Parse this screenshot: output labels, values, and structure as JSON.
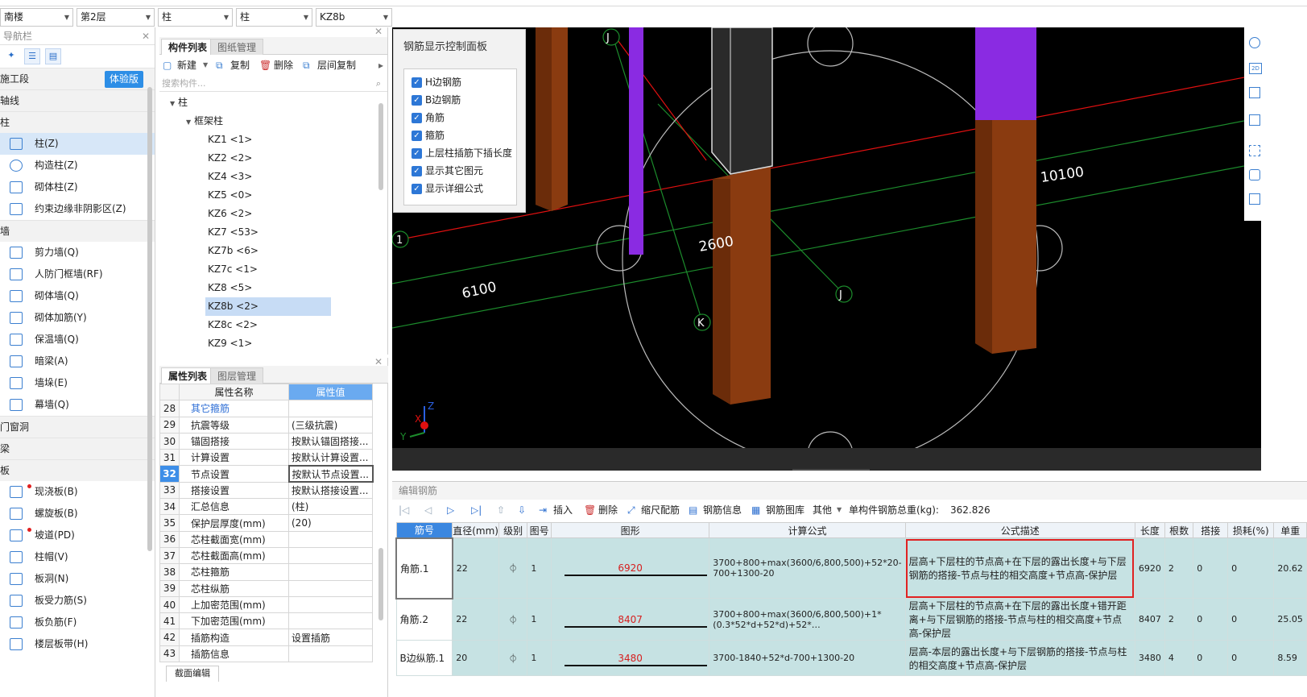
{
  "top_selectors": [
    {
      "value": "南楼"
    },
    {
      "value": "第2层"
    },
    {
      "value": "柱"
    },
    {
      "value": "柱"
    },
    {
      "value": "KZ8b"
    }
  ],
  "nav": {
    "title": "导航栏",
    "badge": "体验版",
    "groups": [
      {
        "label": "施工段"
      },
      {
        "label": "轴线"
      },
      {
        "label": "柱"
      },
      {
        "label": "墙"
      },
      {
        "label": "门窗洞"
      },
      {
        "label": "梁"
      },
      {
        "label": "板"
      }
    ],
    "column_items": [
      {
        "label": "柱(Z)"
      },
      {
        "label": "构造柱(Z)"
      },
      {
        "label": "砌体柱(Z)"
      },
      {
        "label": "约束边缘非阴影区(Z)"
      }
    ],
    "wall_items": [
      {
        "label": "剪力墙(Q)"
      },
      {
        "label": "人防门框墙(RF)"
      },
      {
        "label": "砌体墙(Q)"
      },
      {
        "label": "砌体加筋(Y)"
      },
      {
        "label": "保温墙(Q)"
      },
      {
        "label": "暗梁(A)"
      },
      {
        "label": "墙垛(E)"
      },
      {
        "label": "幕墙(Q)"
      }
    ],
    "slab_items": [
      {
        "label": "现浇板(B)"
      },
      {
        "label": "螺旋板(B)"
      },
      {
        "label": "坡道(PD)"
      },
      {
        "label": "柱帽(V)"
      },
      {
        "label": "板洞(N)"
      },
      {
        "label": "板受力筋(S)"
      },
      {
        "label": "板负筋(F)"
      },
      {
        "label": "楼层板带(H)"
      }
    ]
  },
  "components": {
    "tabs": [
      "构件列表",
      "图纸管理"
    ],
    "toolbar": {
      "new": "新建",
      "copy": "复制",
      "delete": "删除",
      "floor_copy": "层间复制"
    },
    "search_placeholder": "搜索构件...",
    "root": "柱",
    "sub": "框架柱",
    "items": [
      "KZ1 <1>",
      "KZ2 <2>",
      "KZ4 <3>",
      "KZ5 <0>",
      "KZ6 <2>",
      "KZ7 <53>",
      "KZ7b <6>",
      "KZ7c <1>",
      "KZ8 <5>",
      "KZ8b <2>",
      "KZ8c <2>",
      "KZ9 <1>"
    ],
    "selected": "KZ8b <2>"
  },
  "properties": {
    "tabs": [
      "属性列表",
      "图层管理"
    ],
    "headers": {
      "name": "属性名称",
      "value": "属性值"
    },
    "rows": [
      {
        "n": "28",
        "k": "其它箍筋",
        "v": ""
      },
      {
        "n": "29",
        "k": "抗震等级",
        "v": "(三级抗震)"
      },
      {
        "n": "30",
        "k": "锚固搭接",
        "v": "按默认锚固搭接..."
      },
      {
        "n": "31",
        "k": "计算设置",
        "v": "按默认计算设置..."
      },
      {
        "n": "32",
        "k": "节点设置",
        "v": "按默认节点设置..."
      },
      {
        "n": "33",
        "k": "搭接设置",
        "v": "按默认搭接设置..."
      },
      {
        "n": "34",
        "k": "汇总信息",
        "v": "(柱)"
      },
      {
        "n": "35",
        "k": "保护层厚度(mm)",
        "v": "(20)"
      },
      {
        "n": "36",
        "k": "芯柱截面宽(mm)",
        "v": ""
      },
      {
        "n": "37",
        "k": "芯柱截面高(mm)",
        "v": ""
      },
      {
        "n": "38",
        "k": "芯柱箍筋",
        "v": ""
      },
      {
        "n": "39",
        "k": "芯柱纵筋",
        "v": ""
      },
      {
        "n": "40",
        "k": "上加密范围(mm)",
        "v": ""
      },
      {
        "n": "41",
        "k": "下加密范围(mm)",
        "v": ""
      },
      {
        "n": "42",
        "k": "插筋构造",
        "v": "设置插筋"
      },
      {
        "n": "43",
        "k": "插筋信息",
        "v": ""
      }
    ],
    "footer_tab": "截面编辑"
  },
  "rebar_panel": {
    "title": "钢筋显示控制面板",
    "options": [
      "H边钢筋",
      "B边钢筋",
      "角筋",
      "箍筋",
      "上层柱插筋下插长度",
      "显示其它图元",
      "显示详细公式"
    ]
  },
  "view_labels": {
    "dims": [
      "10100",
      "2600",
      "6100"
    ],
    "axes": [
      "J",
      "J",
      "K",
      "1"
    ],
    "gizmo": [
      "Z",
      "X",
      "Y"
    ]
  },
  "colors": {
    "accent": "#2d8ee6",
    "column": "#8a3b10",
    "rebar": "#8a2be2",
    "axis_red": "#e01010",
    "axis_green": "#1c8c2c"
  },
  "editor": {
    "title": "编辑钢筋",
    "toolbar": {
      "insert": "插入",
      "delete": "删除",
      "scale": "缩尺配筋",
      "info": "钢筋信息",
      "library": "钢筋图库",
      "other": "其他",
      "total_label": "单构件钢筋总重(kg):",
      "total": "362.826"
    },
    "headers": [
      "筋号",
      "直径(mm)",
      "级别",
      "图号",
      "图形",
      "计算公式",
      "公式描述",
      "长度",
      "根数",
      "搭接",
      "损耗(%)",
      "单重"
    ],
    "rows": [
      {
        "idx": "1",
        "name": "角筋.1",
        "dia": "22",
        "grade": "⏀",
        "fig": "1",
        "shape": "6920",
        "formula": "3700+800+max(3600/6,800,500)+52*20-700+1300-20",
        "desc": "层高+下层柱的节点高+在下层的露出长度+与下层钢筋的搭接-节点与柱的相交高度+节点高-保护层",
        "len": "6920",
        "count": "2",
        "lap": "0",
        "loss": "0",
        "unit": "20.62"
      },
      {
        "idx": "2",
        "name": "角筋.2",
        "dia": "22",
        "grade": "⏀",
        "fig": "1",
        "shape": "8407",
        "formula": "3700+800+max(3600/6,800,500)+1*(0.3*52*d+52*d)+52*…",
        "desc": "层高+下层柱的节点高+在下层的露出长度+错开距离+与下层钢筋的搭接-节点与柱的相交高度+节点高-保护层",
        "len": "8407",
        "count": "2",
        "lap": "0",
        "loss": "0",
        "unit": "25.05"
      },
      {
        "idx": "3",
        "name": "B边纵筋.1",
        "dia": "20",
        "grade": "⏀",
        "fig": "1",
        "shape": "3480",
        "formula": "3700-1840+52*d-700+1300-20",
        "desc": "层高-本层的露出长度+与下层钢筋的搭接-节点与柱的相交高度+节点高-保护层",
        "len": "3480",
        "count": "4",
        "lap": "0",
        "loss": "0",
        "unit": "8.59"
      }
    ]
  }
}
